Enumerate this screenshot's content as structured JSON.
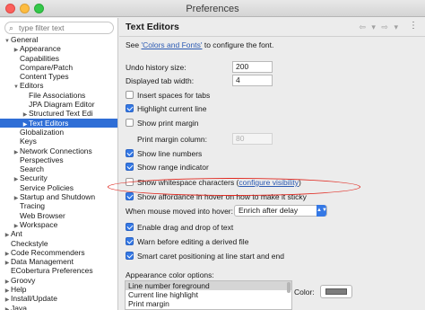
{
  "window": {
    "title": "Preferences"
  },
  "filter": {
    "placeholder": "type filter text"
  },
  "tree": [
    {
      "label": "General",
      "level": 0,
      "twisty": "open"
    },
    {
      "label": "Appearance",
      "level": 1,
      "twisty": "closed"
    },
    {
      "label": "Capabilities",
      "level": 1,
      "twisty": "none"
    },
    {
      "label": "Compare/Patch",
      "level": 1,
      "twisty": "none"
    },
    {
      "label": "Content Types",
      "level": 1,
      "twisty": "none"
    },
    {
      "label": "Editors",
      "level": 1,
      "twisty": "open"
    },
    {
      "label": "File Associations",
      "level": 2,
      "twisty": "none"
    },
    {
      "label": "JPA Diagram Editor",
      "level": 2,
      "twisty": "none"
    },
    {
      "label": "Structured Text Edi",
      "level": 2,
      "twisty": "closed"
    },
    {
      "label": "Text Editors",
      "level": 2,
      "twisty": "closed",
      "selected": true
    },
    {
      "label": "Globalization",
      "level": 1,
      "twisty": "none"
    },
    {
      "label": "Keys",
      "level": 1,
      "twisty": "none"
    },
    {
      "label": "Network Connections",
      "level": 1,
      "twisty": "closed"
    },
    {
      "label": "Perspectives",
      "level": 1,
      "twisty": "none"
    },
    {
      "label": "Search",
      "level": 1,
      "twisty": "none"
    },
    {
      "label": "Security",
      "level": 1,
      "twisty": "closed"
    },
    {
      "label": "Service Policies",
      "level": 1,
      "twisty": "none"
    },
    {
      "label": "Startup and Shutdown",
      "level": 1,
      "twisty": "closed"
    },
    {
      "label": "Tracing",
      "level": 1,
      "twisty": "none"
    },
    {
      "label": "Web Browser",
      "level": 1,
      "twisty": "none"
    },
    {
      "label": "Workspace",
      "level": 1,
      "twisty": "closed"
    },
    {
      "label": "Ant",
      "level": 0,
      "twisty": "closed"
    },
    {
      "label": "Checkstyle",
      "level": 0,
      "twisty": "none"
    },
    {
      "label": "Code Recommenders",
      "level": 0,
      "twisty": "closed"
    },
    {
      "label": "Data Management",
      "level": 0,
      "twisty": "closed"
    },
    {
      "label": "ECobertura Preferences",
      "level": 0,
      "twisty": "none"
    },
    {
      "label": "Groovy",
      "level": 0,
      "twisty": "closed"
    },
    {
      "label": "Help",
      "level": 0,
      "twisty": "closed"
    },
    {
      "label": "Install/Update",
      "level": 0,
      "twisty": "closed"
    },
    {
      "label": "Java",
      "level": 0,
      "twisty": "closed"
    }
  ],
  "page": {
    "title": "Text Editors",
    "nav_arrows": "⇦ ▾ ⇨ ▾",
    "menu": "⋮",
    "desc_prefix": "See ",
    "desc_link": "'Colors and Fonts'",
    "desc_suffix": " to configure the font.",
    "undo_label": "Undo history size:",
    "undo_value": "200",
    "tab_label": "Displayed tab width:",
    "tab_value": "4",
    "opt_spaces": "Insert spaces for tabs",
    "opt_highlight": "Highlight current line",
    "opt_margin": "Show print margin",
    "margin_col_label": "Print margin column:",
    "margin_col_value": "80",
    "opt_line_numbers": "Show line numbers",
    "opt_range": "Show range indicator",
    "opt_whitespace": "Show whitespace characters (",
    "opt_whitespace_link": "configure visibility",
    "opt_whitespace_end": ")",
    "opt_affordance": "Show affordance in hover on how to make it sticky",
    "hover_label": "When mouse moved into hover:",
    "hover_value": "Enrich after delay",
    "opt_drag": "Enable drag and drop of text",
    "opt_derived": "Warn before editing a derived file",
    "opt_caret": "Smart caret positioning at line start and end",
    "color_options_label": "Appearance color options:",
    "color_items": [
      "Line number foreground",
      "Current line highlight",
      "Print margin"
    ],
    "color_label": "Color:",
    "swatch_color": "#7c7c7c"
  },
  "checkbox_state": {
    "spaces": false,
    "highlight": true,
    "margin": false,
    "line_numbers": true,
    "range": true,
    "whitespace": false,
    "affordance": true,
    "drag": true,
    "derived": true,
    "caret": true
  }
}
